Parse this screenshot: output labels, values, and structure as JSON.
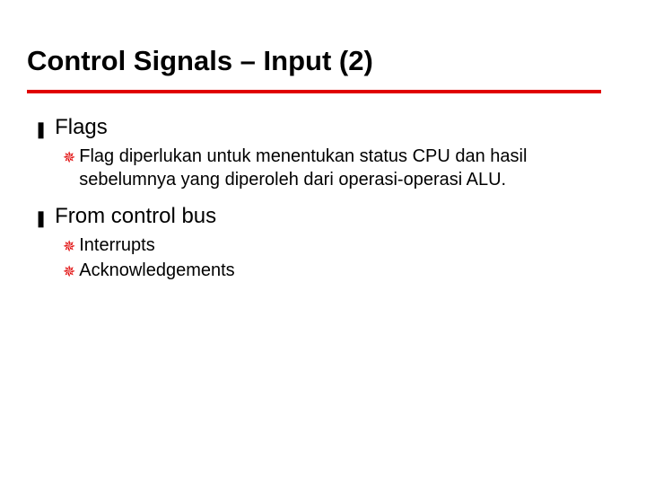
{
  "title": "Control Signals – Input (2)",
  "items": [
    {
      "label": "Flags",
      "children": [
        {
          "text": "Flag diperlukan untuk menentukan status CPU dan hasil sebelumnya yang diperoleh dari operasi-operasi ALU."
        }
      ]
    },
    {
      "label": "From control bus",
      "children": [
        {
          "text": "Interrupts"
        },
        {
          "text": "Acknowledgements"
        }
      ]
    }
  ],
  "bullets": {
    "level1": "❚",
    "level2": "✵"
  },
  "colors": {
    "rule": "#e00000",
    "subbullet": "#e00000"
  }
}
